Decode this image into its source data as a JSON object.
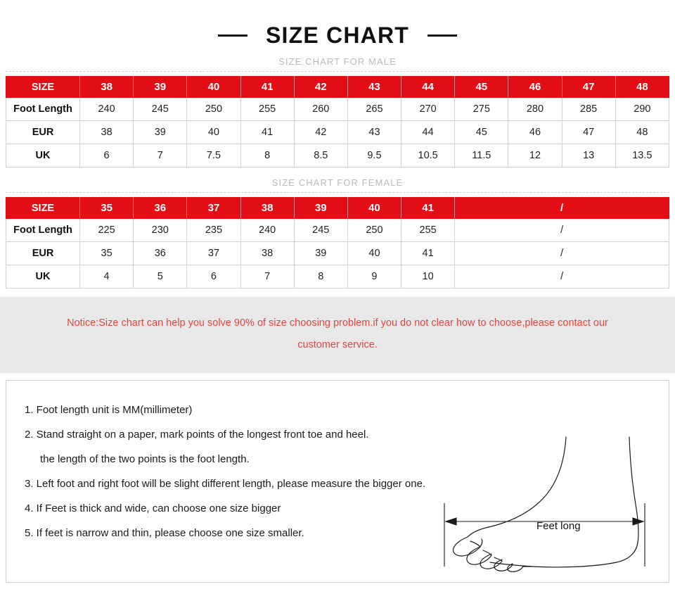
{
  "header": {
    "title": "SIZE CHART",
    "left_dash": "—",
    "right_dash": "—"
  },
  "male_section": {
    "subtitle": "SIZE CHART FOR MALE",
    "corner_label": "SIZE",
    "sizes": [
      "38",
      "39",
      "40",
      "41",
      "42",
      "43",
      "44",
      "45",
      "46",
      "47",
      "48"
    ],
    "rows": [
      {
        "label": "Foot Length",
        "values": [
          "240",
          "245",
          "250",
          "255",
          "260",
          "265",
          "270",
          "275",
          "280",
          "285",
          "290"
        ]
      },
      {
        "label": "EUR",
        "values": [
          "38",
          "39",
          "40",
          "41",
          "42",
          "43",
          "44",
          "45",
          "46",
          "47",
          "48"
        ]
      },
      {
        "label": "UK",
        "values": [
          "6",
          "7",
          "7.5",
          "8",
          "8.5",
          "9.5",
          "10.5",
          "11.5",
          "12",
          "13",
          "13.5"
        ]
      }
    ]
  },
  "female_section": {
    "subtitle": "SIZE CHART FOR FEMALE",
    "corner_label": "SIZE",
    "sizes": [
      "35",
      "36",
      "37",
      "38",
      "39",
      "40",
      "41"
    ],
    "empty_span_label": "/",
    "empty_span_cols": 4,
    "rows": [
      {
        "label": "Foot Length",
        "values": [
          "225",
          "230",
          "235",
          "240",
          "245",
          "250",
          "255"
        ],
        "span_value": "/"
      },
      {
        "label": "EUR",
        "values": [
          "35",
          "36",
          "37",
          "38",
          "39",
          "40",
          "41"
        ],
        "span_value": "/"
      },
      {
        "label": "UK",
        "values": [
          "4",
          "5",
          "6",
          "7",
          "8",
          "9",
          "10"
        ],
        "span_value": "/"
      }
    ]
  },
  "notice": {
    "line1": "Notice:Size chart can help you solve 90% of size choosing problem.if you do not clear how to choose,please contact our",
    "line2": "customer service."
  },
  "instructions": {
    "items": [
      "1. Foot length unit is MM(millimeter)",
      "2. Stand straight on a paper, mark points of the longest front toe and heel.",
      "the length of the two points is the foot length.",
      "3. Left foot and right foot will be slight different length, please measure the bigger one.",
      "4. If Feet is thick and wide, can choose one size bigger",
      "5. If feet is narrow and thin, please choose one size smaller."
    ]
  },
  "diagram": {
    "measure_label": "Feet long"
  },
  "colors": {
    "header_red": "#e30d16",
    "notice_red": "#e8453c",
    "notice_band_bg": "#e8e8e8",
    "subtitle_gray": "#b9b9b9",
    "border_gray": "#d2d2d2"
  }
}
